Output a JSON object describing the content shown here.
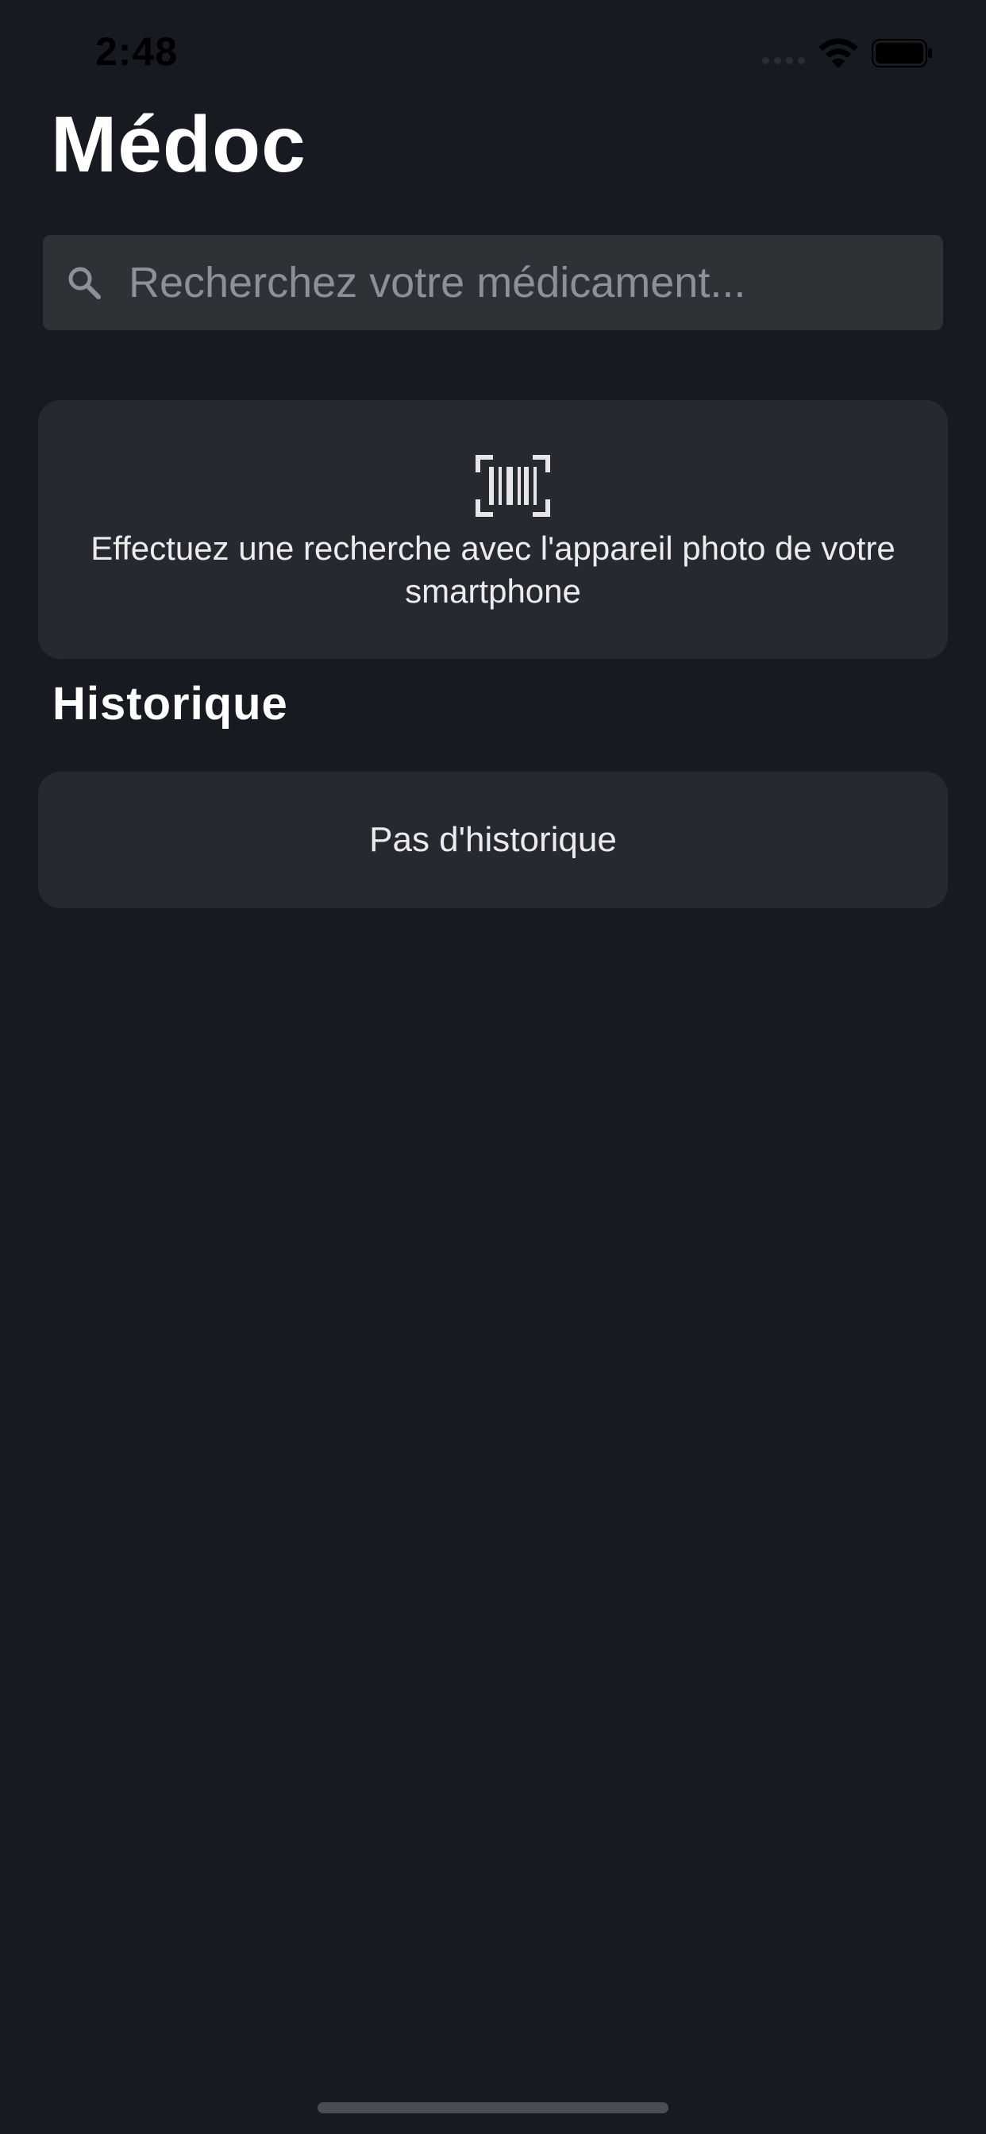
{
  "status_bar": {
    "time": "2:48",
    "icons": [
      "signal-icon",
      "wifi-icon",
      "battery-icon"
    ]
  },
  "header": {
    "title": "Médoc"
  },
  "search": {
    "placeholder": "Recherchez votre médicament...",
    "value": "",
    "icon": "search-icon"
  },
  "scan_card": {
    "icon": "barcode-scan-icon",
    "text": "Effectuez une recherche avec l'appareil photo de votre smartphone"
  },
  "history": {
    "heading": "Historique",
    "empty_text": "Pas d'historique"
  },
  "colors": {
    "background": "#171a20",
    "card": "#272930",
    "search_field": "#2e3237",
    "text_primary": "#ffffff",
    "placeholder": "#8c9198"
  }
}
